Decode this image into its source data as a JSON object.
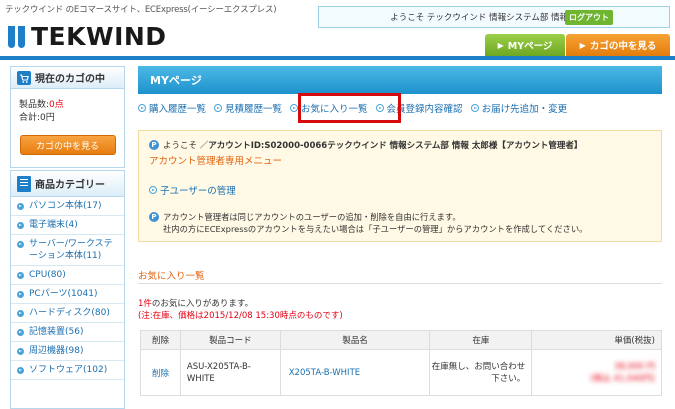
{
  "header": {
    "tagline": "テックウインド のEコマースサイト、ECExpress(イーシーエクスプレス)",
    "logo_text": "TEKWIND",
    "welcome": "ようこそ テックウインド 情報システム部 情報 太郎 様",
    "logout_label": "ログアウト",
    "nav": {
      "mypage": "MYページ",
      "cart": "カゴの中を見る"
    }
  },
  "sidebar": {
    "cart": {
      "title": "現在のカゴの中",
      "count_label": "製品数:",
      "count_value": "0点",
      "total_label": "合計:",
      "total_value": "0円",
      "button": "カゴの中を見る"
    },
    "categories": {
      "title": "商品カテゴリー",
      "items": [
        "パソコン本体(17)",
        "電子端末(4)",
        "サーバー/ワークステーション本体(11)",
        "CPU(80)",
        "PCパーツ(1041)",
        "ハードディスク(80)",
        "記憶装置(56)",
        "周辺機器(98)",
        "ソフトウェア(102)"
      ]
    }
  },
  "main": {
    "title": "MYページ",
    "tabs": [
      "購入履歴一覧",
      "見積履歴一覧",
      "お気に入り一覧",
      "会員登録内容確認",
      "お届け先追加・変更"
    ],
    "account": {
      "prefix": "ようこそ ／ ",
      "id_text": "アカウントID:S02000-0066",
      "name_text": " テックウインド 情報システム部 情報 太郎様【アカウント管理者】",
      "menu_title": "アカウント管理者専用メニュー",
      "child_link": "子ユーザーの管理",
      "note_line1": "アカウント管理者は同じアカウントのユーザーの追加・削除を自由に行えます。",
      "note_line2": "社内の方にECExpressのアカウントを与えたい場合は「子ユーザーの管理」からアカウントを作成してください。"
    },
    "favorites": {
      "title": "お気に入り一覧",
      "count_num": "1件",
      "count_text": "のお気に入りがあります。",
      "note": "(注:在庫、価格は2015/12/08 15:30時点のものです)",
      "headers": [
        "削除",
        "製品コード",
        "製品名",
        "在庫",
        "単価(税抜)"
      ],
      "row": {
        "delete": "削除",
        "code_line1": "ASU-X205TA-B-",
        "code_line2": "WHITE",
        "name": "X205TA-B-WHITE",
        "stock_line1": "在庫無し、お問い合わせ",
        "stock_line2": "下さい。",
        "price_line1": "38,000 円",
        "price_line2": "(税込 41,040円)"
      }
    }
  },
  "colors": {
    "accent_blue": "#1e7ec8",
    "orange": "#e67c10",
    "green": "#6ea722",
    "red": "#e60012",
    "highlight": "#d50a0a"
  }
}
